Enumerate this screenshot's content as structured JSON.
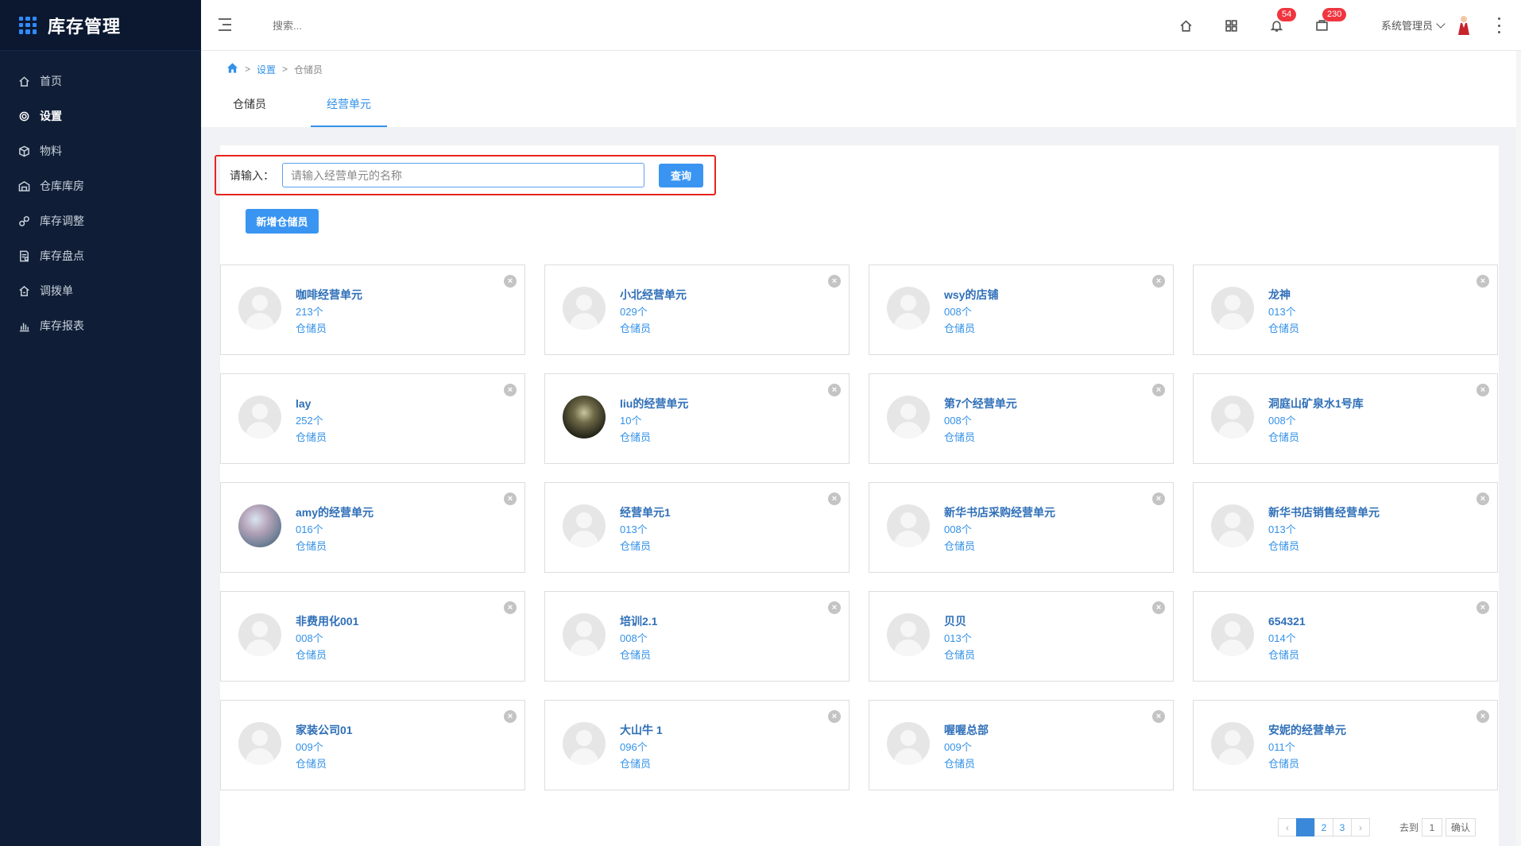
{
  "app": {
    "title": "库存管理"
  },
  "sidebar": {
    "items": [
      {
        "label": "首页",
        "icon": "home-icon"
      },
      {
        "label": "设置",
        "icon": "gear-icon",
        "active": true
      },
      {
        "label": "物料",
        "icon": "cube-icon"
      },
      {
        "label": "仓库库房",
        "icon": "warehouse-icon"
      },
      {
        "label": "库存调整",
        "icon": "adjust-icon"
      },
      {
        "label": "库存盘点",
        "icon": "inventory-check-icon"
      },
      {
        "label": "调拨单",
        "icon": "transfer-icon"
      },
      {
        "label": "库存报表",
        "icon": "bar-chart-icon"
      }
    ]
  },
  "topbar": {
    "search_placeholder": "搜索...",
    "notifications_count": "54",
    "messages_count": "230",
    "user_name": "系统管理员"
  },
  "breadcrumb": {
    "level1": "设置",
    "level2": "仓储员"
  },
  "tabs": [
    {
      "label": "仓储员"
    },
    {
      "label": "经营单元",
      "active": true
    }
  ],
  "search": {
    "label": "请输入：",
    "placeholder": "请输入经营单元的名称",
    "button": "查询"
  },
  "add_button": "新增仓储员",
  "cards": [
    {
      "name": "咖啡经营单元",
      "count": "213个",
      "role": "仓储员",
      "avatar": "default"
    },
    {
      "name": "小北经营单元",
      "count": "029个",
      "role": "仓储员",
      "avatar": "default"
    },
    {
      "name": "wsy的店铺",
      "count": "008个",
      "role": "仓储员",
      "avatar": "default"
    },
    {
      "name": "龙神",
      "count": "013个",
      "role": "仓储员",
      "avatar": "default"
    },
    {
      "name": "lay",
      "count": "252个",
      "role": "仓储员",
      "avatar": "default"
    },
    {
      "name": "liu的经营单元",
      "count": "10个",
      "role": "仓储员",
      "avatar": "photo1"
    },
    {
      "name": "第7个经营单元",
      "count": "008个",
      "role": "仓储员",
      "avatar": "default"
    },
    {
      "name": "洞庭山矿泉水1号库",
      "count": "008个",
      "role": "仓储员",
      "avatar": "default"
    },
    {
      "name": "amy的经营单元",
      "count": "016个",
      "role": "仓储员",
      "avatar": "photo2"
    },
    {
      "name": "经营单元1",
      "count": "013个",
      "role": "仓储员",
      "avatar": "default"
    },
    {
      "name": "新华书店采购经营单元",
      "count": "008个",
      "role": "仓储员",
      "avatar": "default"
    },
    {
      "name": "新华书店销售经营单元",
      "count": "013个",
      "role": "仓储员",
      "avatar": "default"
    },
    {
      "name": "非费用化001",
      "count": "008个",
      "role": "仓储员",
      "avatar": "default"
    },
    {
      "name": "培训2.1",
      "count": "008个",
      "role": "仓储员",
      "avatar": "default"
    },
    {
      "name": "贝贝",
      "count": "013个",
      "role": "仓储员",
      "avatar": "default"
    },
    {
      "name": "654321",
      "count": "014个",
      "role": "仓储员",
      "avatar": "default"
    },
    {
      "name": "家装公司01",
      "count": "009个",
      "role": "仓储员",
      "avatar": "default"
    },
    {
      "name": "大山牛 1",
      "count": "096个",
      "role": "仓储员",
      "avatar": "default"
    },
    {
      "name": "喔喔总部",
      "count": "009个",
      "role": "仓储员",
      "avatar": "default"
    },
    {
      "name": "安妮的经营单元",
      "count": "011个",
      "role": "仓储员",
      "avatar": "default"
    }
  ],
  "pagination": {
    "prev": "‹",
    "pages": [
      "1",
      "2",
      "3"
    ],
    "current": "1",
    "next": "›",
    "goto_label": "去到",
    "goto_value": "1",
    "confirm": "确认"
  },
  "colors": {
    "sidebar_bg": "#0f1e36",
    "accent": "#3291e8",
    "badge": "#f0353f",
    "highlight_border": "#e8231c"
  }
}
